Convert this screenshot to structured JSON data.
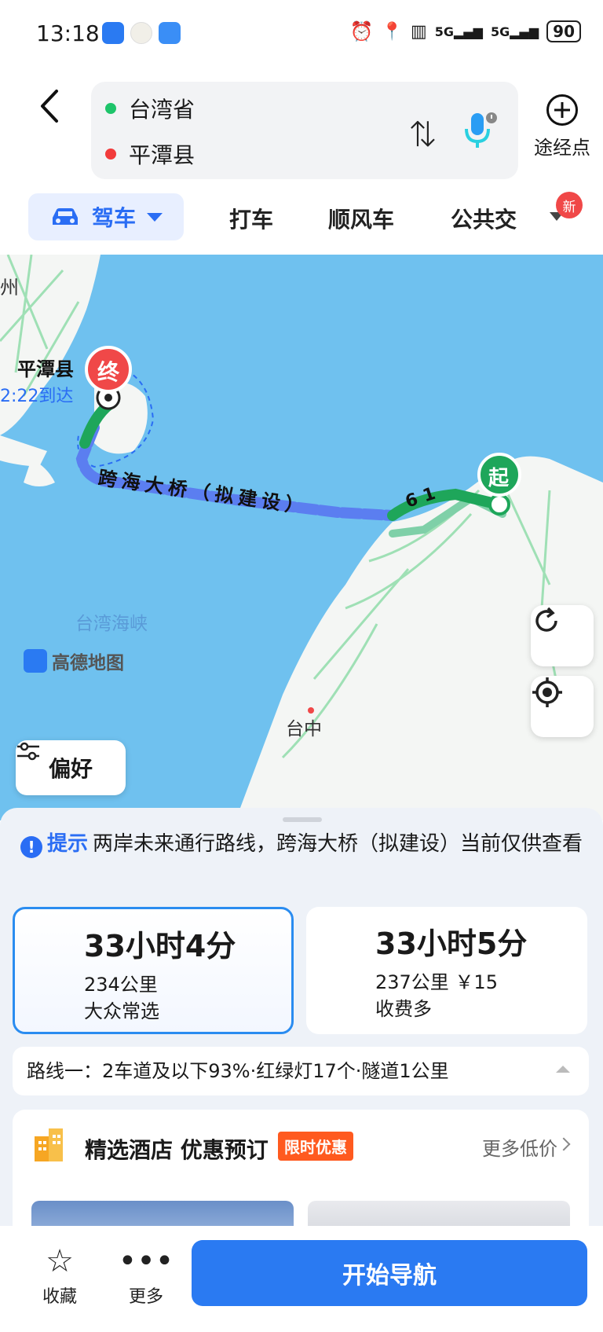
{
  "status_bar": {
    "time": "13:18",
    "battery": "90"
  },
  "header": {
    "origin": "台湾省",
    "destination": "平潭县",
    "via_label": "途经点",
    "colors": {
      "origin_dot": "#1ec46a",
      "destination_dot": "#f23b3b"
    }
  },
  "mode_tabs": {
    "active": "驾车",
    "items": [
      "打车",
      "顺风车",
      "公共交"
    ],
    "new_badge": "新"
  },
  "map": {
    "dest_label": "平潭县",
    "dest_marker": "终",
    "arrival_partial": "2:22到达",
    "origin_marker": "起",
    "bridge_label": "跨海大桥（拟建设）",
    "road_number": "61",
    "city_partial": "州",
    "strait_label": "台湾海峡",
    "brand": "高德地图",
    "city_label": "台中",
    "preference_label": "偏好"
  },
  "sheet": {
    "tip_key": "提示",
    "tip_text": "两岸未来通行路线，跨海大桥（拟建设）当前仅供查看",
    "routes": [
      {
        "time": "33小时4分",
        "distance": "234公里",
        "note": "大众常选"
      },
      {
        "time": "33小时5分",
        "distance": "237公里 ￥15",
        "note": "收费多"
      }
    ],
    "route_summary": "路线一：2车道及以下93%·红绿灯17个·隧道1公里",
    "hotel": {
      "title": "精选酒店 优惠预订",
      "tag": "限时优惠",
      "more": "更多低价"
    }
  },
  "bottom_bar": {
    "favorite": "收藏",
    "more": "更多",
    "start": "开始导航"
  }
}
